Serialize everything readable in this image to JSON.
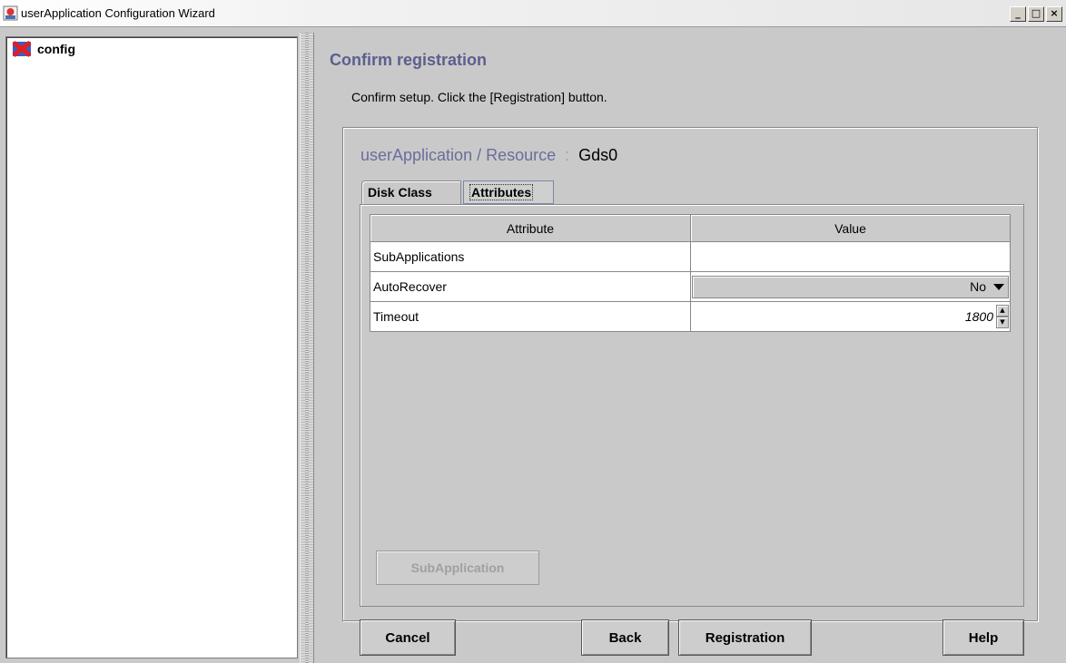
{
  "window": {
    "title": "userApplication Configuration Wizard",
    "controls": {
      "minimize": "_",
      "maximize": "□",
      "close": "×"
    }
  },
  "tree": {
    "root": {
      "label": "config",
      "icon": "config-icon"
    }
  },
  "main": {
    "page_title": "Confirm registration",
    "instruction": "Confirm setup.  Click the [Registration] button.",
    "resource": {
      "label": "userApplication / Resource",
      "separator": ":",
      "value": "Gds0"
    },
    "tabs": [
      {
        "label": "Disk Class",
        "selected": false
      },
      {
        "label": "Attributes",
        "selected": true
      }
    ],
    "table": {
      "headers": [
        "Attribute",
        "Value"
      ],
      "rows": [
        {
          "attribute": "SubApplications",
          "value": ""
        },
        {
          "attribute": "AutoRecover",
          "value": "No"
        },
        {
          "attribute": "Timeout",
          "value": "1800"
        }
      ]
    },
    "subapplication_button": "SubApplication"
  },
  "footer": {
    "cancel": "Cancel",
    "back": "Back",
    "registration": "Registration",
    "help": "Help"
  },
  "colors": {
    "title_accent": "#5b5f8f",
    "resource_label": "#6a6d9c",
    "background": "#c9c9c9"
  }
}
